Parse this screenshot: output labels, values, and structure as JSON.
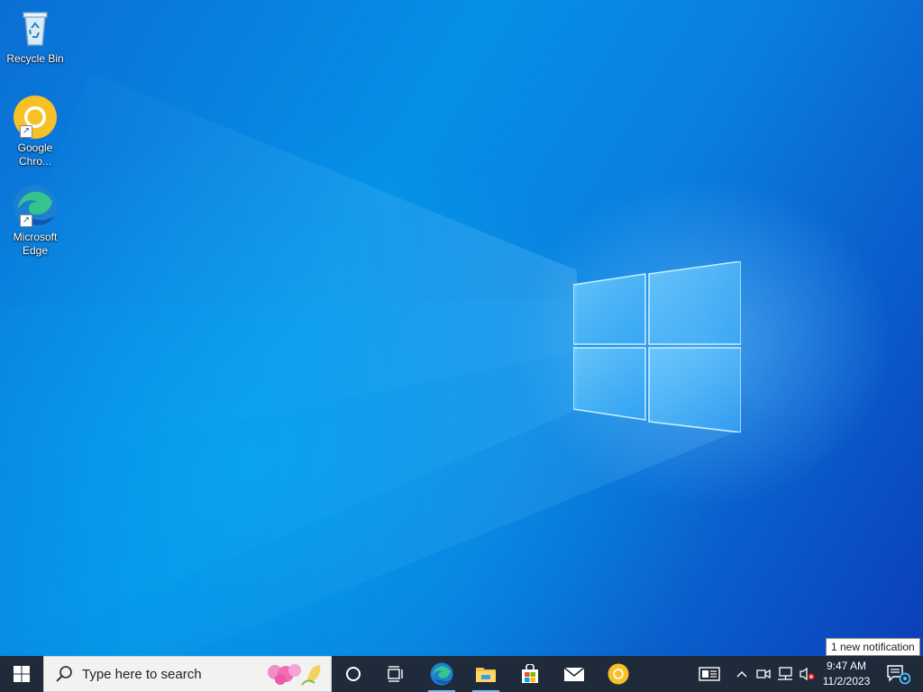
{
  "desktop": {
    "icons": [
      {
        "label": "Recycle Bin",
        "icon": "recycle-bin-icon"
      },
      {
        "label": "Google\nChro...",
        "line1": "Google",
        "line2": "Chro...",
        "icon": "chrome-icon"
      },
      {
        "label": "Microsoft\nEdge",
        "line1": "Microsoft",
        "line2": "Edge",
        "icon": "edge-icon"
      }
    ],
    "wallpaper": "windows-logo-wallpaper"
  },
  "taskbar": {
    "search_placeholder": "Type here to search",
    "pinned": [
      "start-icon",
      "cortana-icon",
      "task-view-icon",
      "edge-icon",
      "file-explorer-icon",
      "store-icon",
      "mail-icon",
      "chrome-icon"
    ],
    "tray": {
      "time": "9:47 AM",
      "date": "11/2/2023",
      "tooltip": "1 new notification",
      "icons": [
        "news-icon",
        "show-hidden-icons-chevron",
        "meet-now-icon",
        "network-icon",
        "volume-muted-icon",
        "notification-center-icon"
      ]
    }
  },
  "colors": {
    "taskbar": "#1f2b3a",
    "accent": "#0a78d7",
    "running_indicator": "#76b9ed"
  }
}
